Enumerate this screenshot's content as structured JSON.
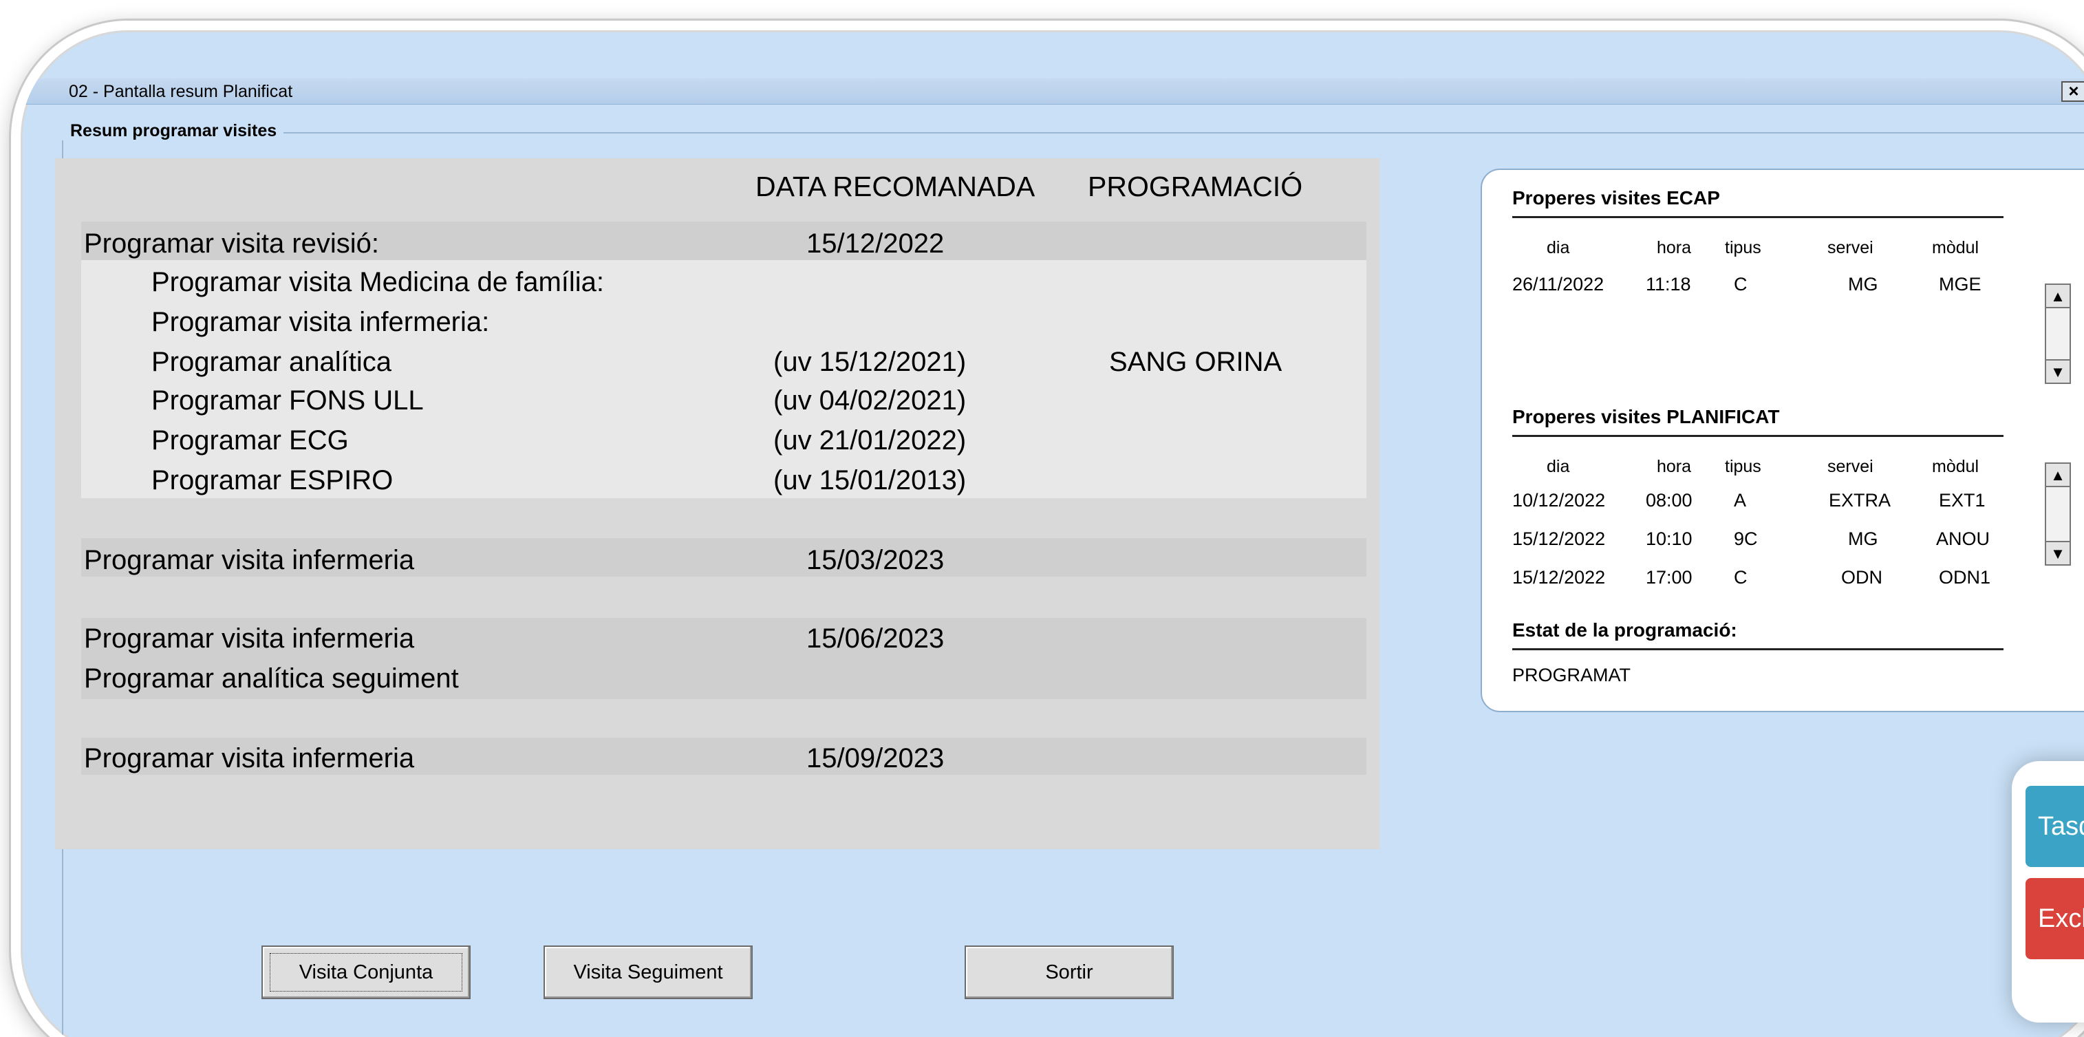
{
  "window": {
    "title": "02 - Pantalla resum Planificat",
    "close_label": "×"
  },
  "group": {
    "legend": "Resum programar visites"
  },
  "table": {
    "headers": {
      "date": "DATA RECOMANADA",
      "program": "PROGRAMACIÓ"
    },
    "rows": [
      {
        "label": "Programar visita revisió:",
        "date": "15/12/2022",
        "prog": ""
      },
      {
        "label": "Programar visita Medicina de família:",
        "date": "",
        "prog": ""
      },
      {
        "label": "Programar visita infermeria:",
        "date": "",
        "prog": ""
      },
      {
        "label": "Programar analítica",
        "date": "(uv 15/12/2021)",
        "prog": "SANG ORINA"
      },
      {
        "label": "Programar FONS ULL",
        "date": "(uv 04/02/2021)",
        "prog": ""
      },
      {
        "label": "Programar ECG",
        "date": "(uv 21/01/2022)",
        "prog": ""
      },
      {
        "label": "Programar ESPIRO",
        "date": "(uv 15/01/2013)",
        "prog": ""
      },
      {
        "label": "Programar visita infermeria",
        "date": "15/03/2023",
        "prog": ""
      },
      {
        "label": "Programar visita infermeria",
        "date": "15/06/2023",
        "prog": ""
      },
      {
        "label": "Programar analítica seguiment",
        "date": "",
        "prog": ""
      },
      {
        "label": "Programar visita infermeria",
        "date": "15/09/2023",
        "prog": ""
      }
    ]
  },
  "ecap": {
    "title": "Properes visites ECAP",
    "columns": [
      "dia",
      "hora",
      "tipus",
      "servei",
      "mòdul"
    ],
    "rows": [
      [
        "26/11/2022",
        "11:18",
        "C",
        "MG",
        "MGE"
      ]
    ]
  },
  "planificat": {
    "title": "Properes visites PLANIFICAT",
    "columns": [
      "dia",
      "hora",
      "tipus",
      "servei",
      "mòdul"
    ],
    "rows": [
      [
        "10/12/2022",
        "08:00",
        "A",
        "EXTRA",
        "EXT1"
      ],
      [
        "15/12/2022",
        "10:10",
        "9C",
        "MG",
        "ANOU"
      ],
      [
        "15/12/2022",
        "17:00",
        "C",
        "ODN",
        "ODN1"
      ]
    ]
  },
  "estat": {
    "title": "Estat de la programació:",
    "value": "PROGRAMAT"
  },
  "buttons": {
    "conjunta": "Visita Conjunta",
    "seguiment": "Visita Seguiment",
    "sortir": "Sortir"
  },
  "actions": {
    "tasques": "Tasq",
    "exclusio": "Exclus"
  },
  "colors": {
    "window_bg": "#c9e0f6",
    "panel_gray": "#d9d9d9",
    "tasques_bg": "#3aa3c6",
    "exclusio_bg": "#d9433b"
  }
}
